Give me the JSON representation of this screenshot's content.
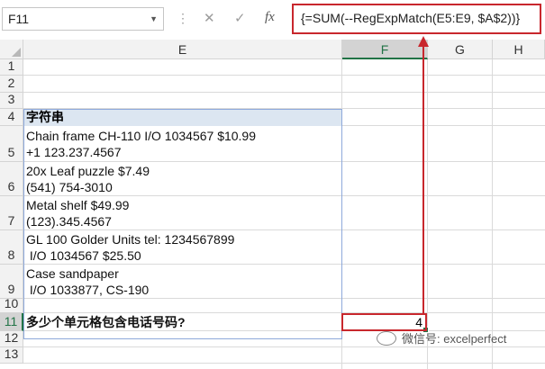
{
  "formula_bar": {
    "name_box": "F11",
    "cancel_icon": "✕",
    "enter_icon": "✓",
    "fx_icon": "fx",
    "formula": "{=SUM(--RegExpMatch(E5:E9, $A$2))}"
  },
  "columns": [
    {
      "label": "E",
      "selected": false
    },
    {
      "label": "F",
      "selected": true
    },
    {
      "label": "G",
      "selected": false
    },
    {
      "label": "H",
      "selected": false
    }
  ],
  "rows": [
    "1",
    "2",
    "3",
    "4",
    "5",
    "6",
    "7",
    "8",
    "9",
    "10",
    "11",
    "12",
    "13"
  ],
  "selected_row": "11",
  "cells": {
    "E4": "字符串",
    "E5": [
      "Chain frame CH-110 I/O 1034567 $10.99",
      "+1 123.237.4567"
    ],
    "E6": [
      "20x Leaf puzzle  $7.49",
      "(541) 754-3010"
    ],
    "E7": [
      "Metal shelf $49.99",
      "(123).345.4567"
    ],
    "E8": [
      "GL 100 Golder Units tel: 1234567899",
      " I/O 1034567 $25.50"
    ],
    "E9": [
      "Case sandpaper",
      " I/O 1033877, CS-190"
    ],
    "E11": "多少个单元格包含电话号码?",
    "F11": "4"
  },
  "colors": {
    "highlight_red": "#c8272d",
    "selection_green": "#217346",
    "header_fill": "#dce6f1"
  },
  "watermark": {
    "text": "微信号: excelperfect",
    "icon": "wechat-icon"
  }
}
